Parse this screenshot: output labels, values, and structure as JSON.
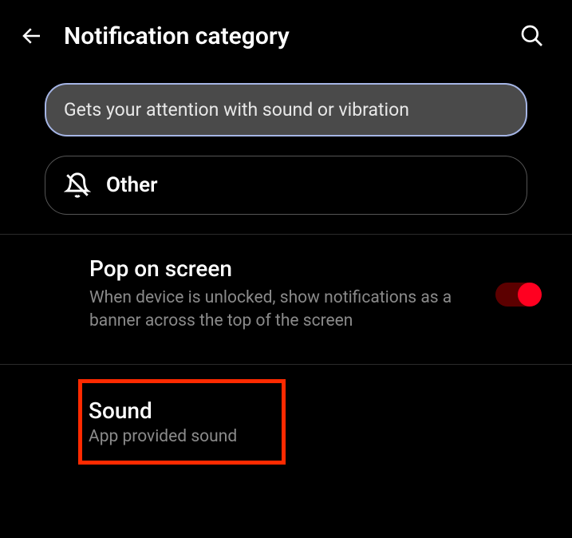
{
  "header": {
    "title": "Notification category"
  },
  "alertOption": {
    "description": "Gets your attention with sound or vibration"
  },
  "otherOption": {
    "label": "Other"
  },
  "popSetting": {
    "title": "Pop on screen",
    "description": "When device is unlocked, show notifications as a banner across the top of the screen"
  },
  "soundSetting": {
    "title": "Sound",
    "description": "App provided sound"
  }
}
